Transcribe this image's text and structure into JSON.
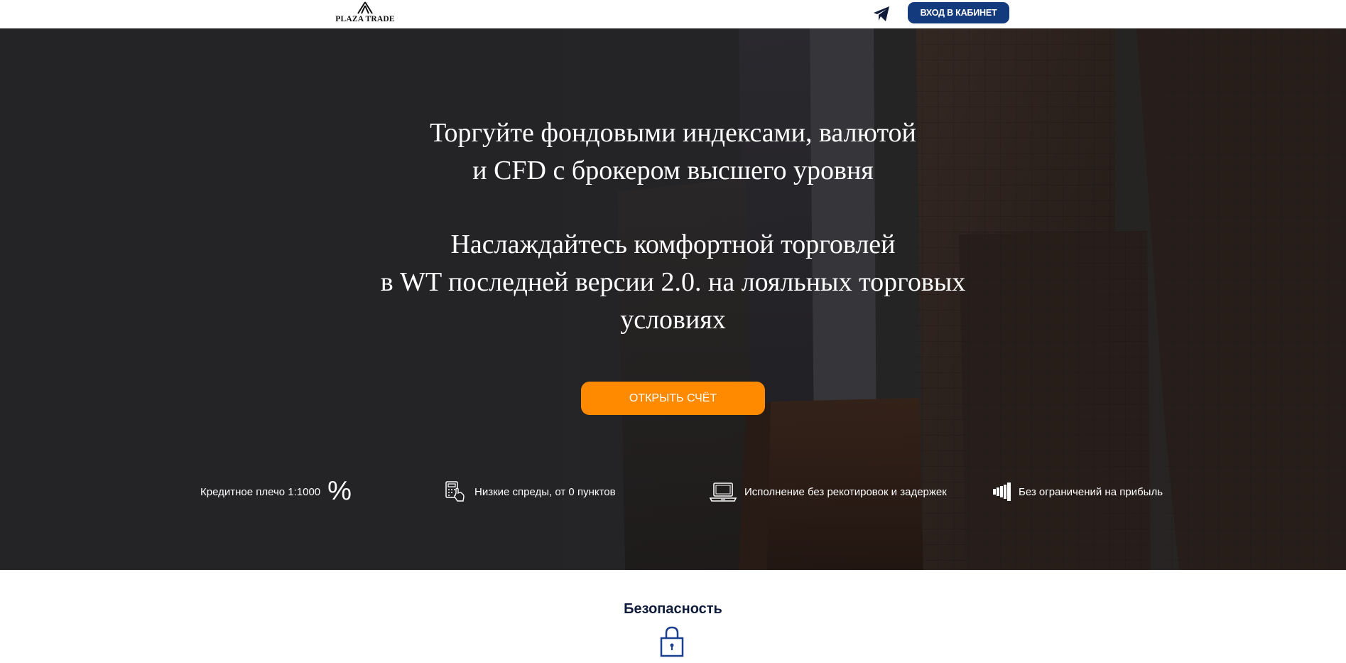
{
  "header": {
    "logo_text": "PLAZA TRADE",
    "telegram_icon": "telegram-paper-plane-icon",
    "login_label": "ВХОД В КАБИНЕТ",
    "login_color": "#133a7c"
  },
  "hero": {
    "headline_1_line_1": "Торгуйте фондовыми индексами, валютой",
    "headline_1_line_2": "и CFD с брокером высшего уровня",
    "headline_2_line_1": "Наслаждайтесь комфортной торговлей",
    "headline_2_line_2": "в WT последней версии 2.0. на лояльных торговых",
    "headline_2_line_3": "условиях",
    "cta_label": "ОТКРЫТЬ СЧЁТ",
    "cta_color": "#ff8a00"
  },
  "features": [
    {
      "label": "Кредитное плечо 1:1000",
      "icon": "percent-icon",
      "icon_glyph": "%"
    },
    {
      "label": "Низкие спреды, от 0 пунктов",
      "icon": "calculator-hand-icon"
    },
    {
      "label": "Исполнение без рекотировок и задержек",
      "icon": "laptop-icon"
    },
    {
      "label": "Без ограничений на прибыль",
      "icon": "volume-bars-icon"
    }
  ],
  "security": {
    "title": "Безопасность",
    "icon": "lock-icon",
    "accent_color": "#1d3f8f"
  }
}
